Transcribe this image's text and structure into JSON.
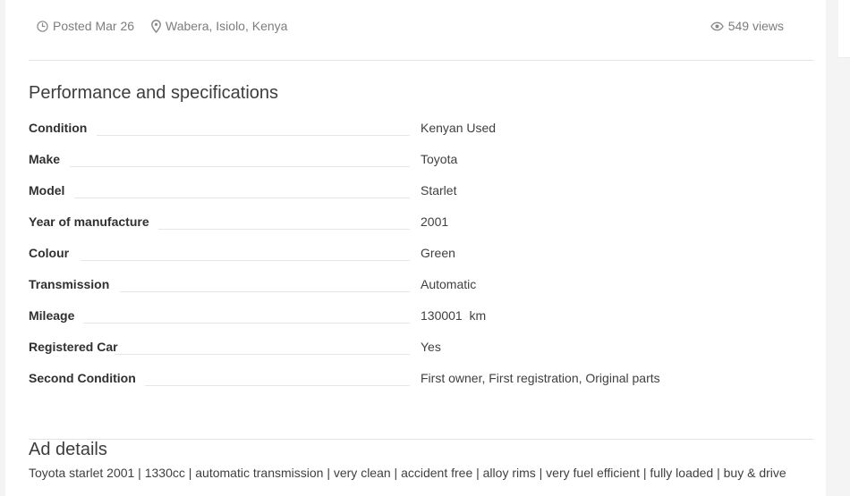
{
  "meta": {
    "posted": "Posted Mar 26",
    "location": "Wabera, Isiolo, Kenya",
    "views": "549 views"
  },
  "specs_section": {
    "title": "Performance and specifications",
    "rows": [
      {
        "label": "Condition",
        "value": "Kenyan Used"
      },
      {
        "label": "Make",
        "value": "Toyota"
      },
      {
        "label": "Model",
        "value": "Starlet"
      },
      {
        "label": "Year of manufacture",
        "value": "2001"
      },
      {
        "label": "Colour",
        "value": "Green"
      },
      {
        "label": "Transmission",
        "value": "Automatic"
      },
      {
        "label": "Mileage",
        "value": "130001  km"
      },
      {
        "label": "Registered Car",
        "value": "Yes"
      },
      {
        "label": "Second Condition",
        "value": "First owner, First registration, Original parts"
      }
    ]
  },
  "ad_details": {
    "title": "Ad details",
    "text": "Toyota starlet 2001 | 1330cc | automatic transmission | very clean | accident free | alloy rims | very fuel efficient | fully loaded | buy & drive"
  },
  "icons": {
    "clock": "clock-icon",
    "location": "map-pin-icon",
    "views": "eye-icon"
  },
  "colors": {
    "meta_text": "#7d7d7d",
    "label_text": "#303030",
    "value_text": "#404040",
    "divider": "#e3e3e3"
  }
}
